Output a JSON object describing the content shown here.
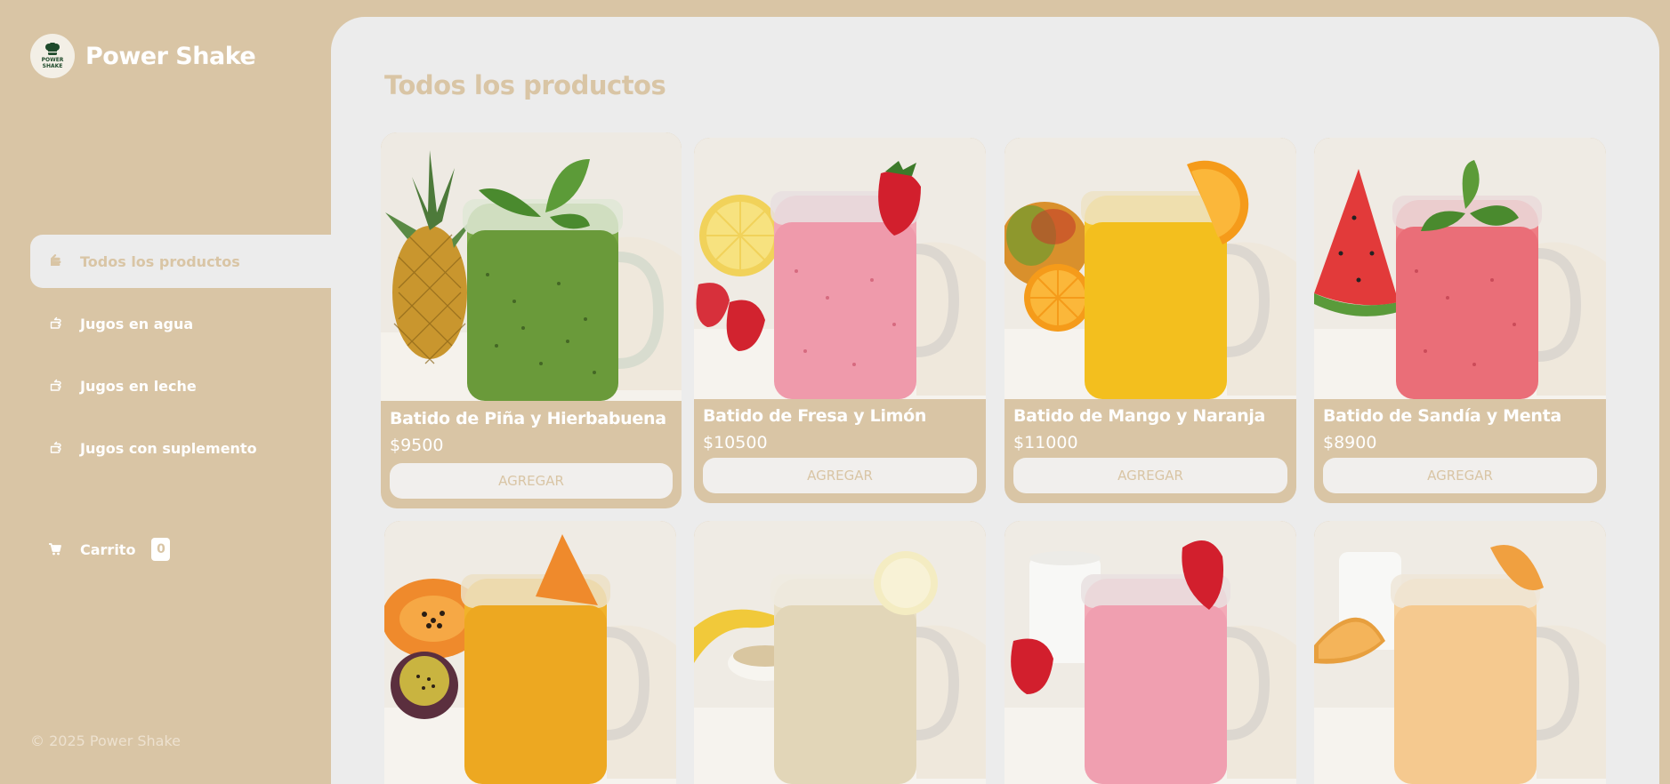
{
  "brand": {
    "name": "Power Shake",
    "logo_text_1": "POWER",
    "logo_text_2": "SHAKE"
  },
  "nav": {
    "items": [
      {
        "label": "Todos los productos",
        "icon": "hand-pointing-icon",
        "active": true
      },
      {
        "label": "Jugos en agua",
        "icon": "hand-pointing-icon",
        "active": false
      },
      {
        "label": "Jugos en leche",
        "icon": "hand-pointing-icon",
        "active": false
      },
      {
        "label": "Jugos con suplemento",
        "icon": "hand-pointing-icon",
        "active": false
      }
    ],
    "cart_label": "Carrito",
    "cart_count": "0"
  },
  "footer": {
    "copyright": "© 2025 Power Shake"
  },
  "main": {
    "title": "Todos los productos"
  },
  "products": [
    {
      "name": "Batido de Piña y Hierbabuena",
      "price": "$9500",
      "button": "AGREGAR"
    },
    {
      "name": "Batido de Fresa y Limón",
      "price": "$10500",
      "button": "AGREGAR"
    },
    {
      "name": "Batido de Mango y Naranja",
      "price": "$11000",
      "button": "AGREGAR"
    },
    {
      "name": "Batido de Sandía y Menta",
      "price": "$8900",
      "button": "AGREGAR"
    }
  ],
  "colors": {
    "primary": "#d9c5a5",
    "background": "#ececec",
    "text_light": "#ffffff"
  }
}
